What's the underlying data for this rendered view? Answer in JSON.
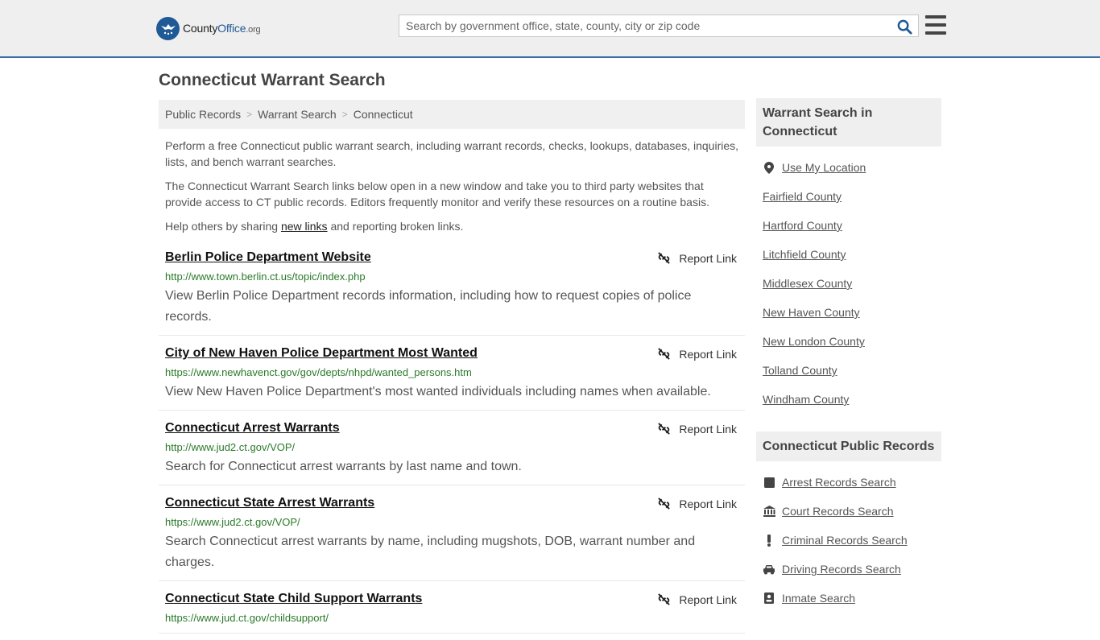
{
  "header": {
    "logo_county": "County",
    "logo_office": "Office",
    "logo_org": ".org",
    "search_placeholder": "Search by government office, state, county, city or zip code"
  },
  "page_title": "Connecticut Warrant Search",
  "breadcrumb": [
    "Public Records",
    "Warrant Search",
    "Connecticut"
  ],
  "intro": {
    "p1": "Perform a free Connecticut public warrant search, including warrant records, checks, lookups, databases, inquiries, lists, and bench warrant searches.",
    "p2": "The Connecticut Warrant Search links below open in a new window and take you to third party websites that provide access to CT public records. Editors frequently monitor and verify these resources on a routine basis.",
    "p3_before": "Help others by sharing ",
    "p3_link": "new links",
    "p3_after": " and reporting broken links."
  },
  "report_label": "Report Link",
  "results": [
    {
      "title": "Berlin Police Department Website",
      "url": "http://www.town.berlin.ct.us/topic/index.php",
      "desc": "View Berlin Police Department records information, including how to request copies of police records."
    },
    {
      "title": "City of New Haven Police Department Most Wanted",
      "url": "https://www.newhavenct.gov/gov/depts/nhpd/wanted_persons.htm",
      "desc": "View New Haven Police Department's most wanted individuals including names when available."
    },
    {
      "title": "Connecticut Arrest Warrants",
      "url": "http://www.jud2.ct.gov/VOP/",
      "desc": "Search for Connecticut arrest warrants by last name and town."
    },
    {
      "title": "Connecticut State Arrest Warrants",
      "url": "https://www.jud2.ct.gov/VOP/",
      "desc": "Search Connecticut arrest warrants by name, including mugshots, DOB, warrant number and charges."
    },
    {
      "title": "Connecticut State Child Support Warrants",
      "url": "https://www.jud.ct.gov/childsupport/",
      "desc": ""
    }
  ],
  "sidebar": {
    "warrant_heading": "Warrant Search in Connecticut",
    "use_location": "Use My Location",
    "counties": [
      "Fairfield County",
      "Hartford County",
      "Litchfield County",
      "Middlesex County",
      "New Haven County",
      "New London County",
      "Tolland County",
      "Windham County"
    ],
    "records_heading": "Connecticut Public Records",
    "records": [
      {
        "label": "Arrest Records Search",
        "icon": "square-icon"
      },
      {
        "label": "Court Records Search",
        "icon": "courthouse-icon"
      },
      {
        "label": "Criminal Records Search",
        "icon": "exclamation-icon"
      },
      {
        "label": "Driving Records Search",
        "icon": "car-icon"
      },
      {
        "label": "Inmate Search",
        "icon": "id-badge-icon"
      }
    ]
  },
  "colors": {
    "brand_blue": "#1f5a96",
    "url_green": "#2a7a2a",
    "header_bg": "#efefef"
  }
}
